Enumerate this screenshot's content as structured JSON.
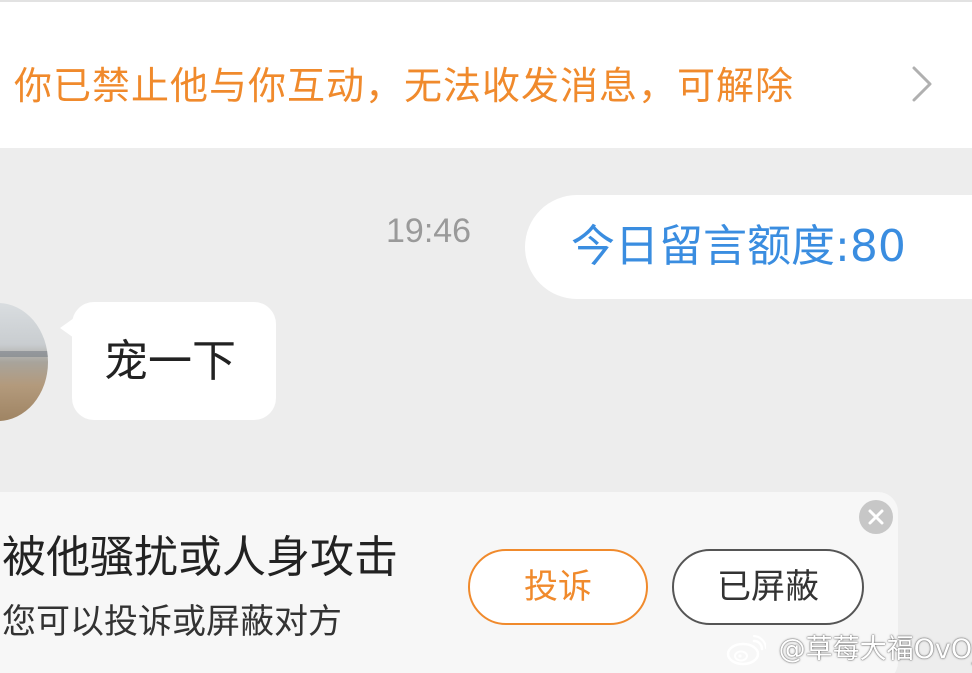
{
  "notice": {
    "text": "你已禁止他与你互动，无法收发消息，可解除",
    "chevron_icon": "chevron-right-icon",
    "color": "#f08a2c"
  },
  "messages": {
    "timestamp": "19:46",
    "outgoing": {
      "text": "今日留言额度:80",
      "color": "#3a8de0"
    },
    "incoming": {
      "text": "宠一下"
    }
  },
  "report_card": {
    "title": "被他骚扰或人身攻击",
    "subtitle": "您可以投诉或屏蔽对方",
    "report_label": "投诉",
    "block_label": "已屏蔽",
    "close_icon": "close-icon"
  },
  "watermark": {
    "text": "@草莓大福OvO_",
    "icon": "weibo-logo-icon"
  }
}
